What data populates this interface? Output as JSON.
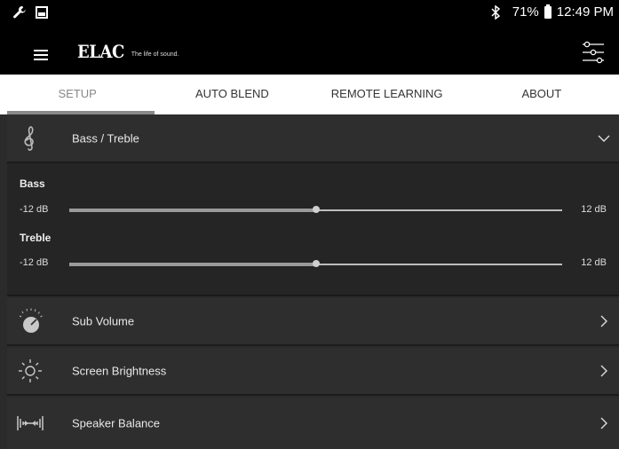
{
  "status_bar": {
    "battery": "71%",
    "time": "12:49 PM",
    "icons": [
      "wrench-icon",
      "image-icon",
      "bluetooth-icon",
      "battery-icon"
    ]
  },
  "app_bar": {
    "logo": "ELAC",
    "tagline": "The life of sound.",
    "icons": [
      "menu-icon",
      "settings-sliders-icon"
    ]
  },
  "tabs": [
    {
      "label": "SETUP",
      "active": true
    },
    {
      "label": "AUTO BLEND",
      "active": false
    },
    {
      "label": "REMOTE LEARNING",
      "active": false
    },
    {
      "label": "ABOUT",
      "active": false
    }
  ],
  "bass_treble": {
    "title": "Bass / Treble",
    "icon": "treble-clef-icon",
    "expanded": true,
    "controls": [
      {
        "label": "Bass",
        "min_label": "-12 dB",
        "max_label": "12 dB",
        "min": -12,
        "max": 12,
        "value": 0
      },
      {
        "label": "Treble",
        "min_label": "-12 dB",
        "max_label": "12 dB",
        "min": -12,
        "max": 12,
        "value": 0
      }
    ]
  },
  "sections": [
    {
      "label": "Sub Volume",
      "icon": "volume-knob-icon"
    },
    {
      "label": "Screen Brightness",
      "icon": "sun-icon"
    },
    {
      "label": "Speaker Balance",
      "icon": "speaker-balance-icon"
    }
  ],
  "colors": {
    "accent_gray": "#8a8a8a",
    "background": "#2b2b2b",
    "bar": "#000000"
  }
}
